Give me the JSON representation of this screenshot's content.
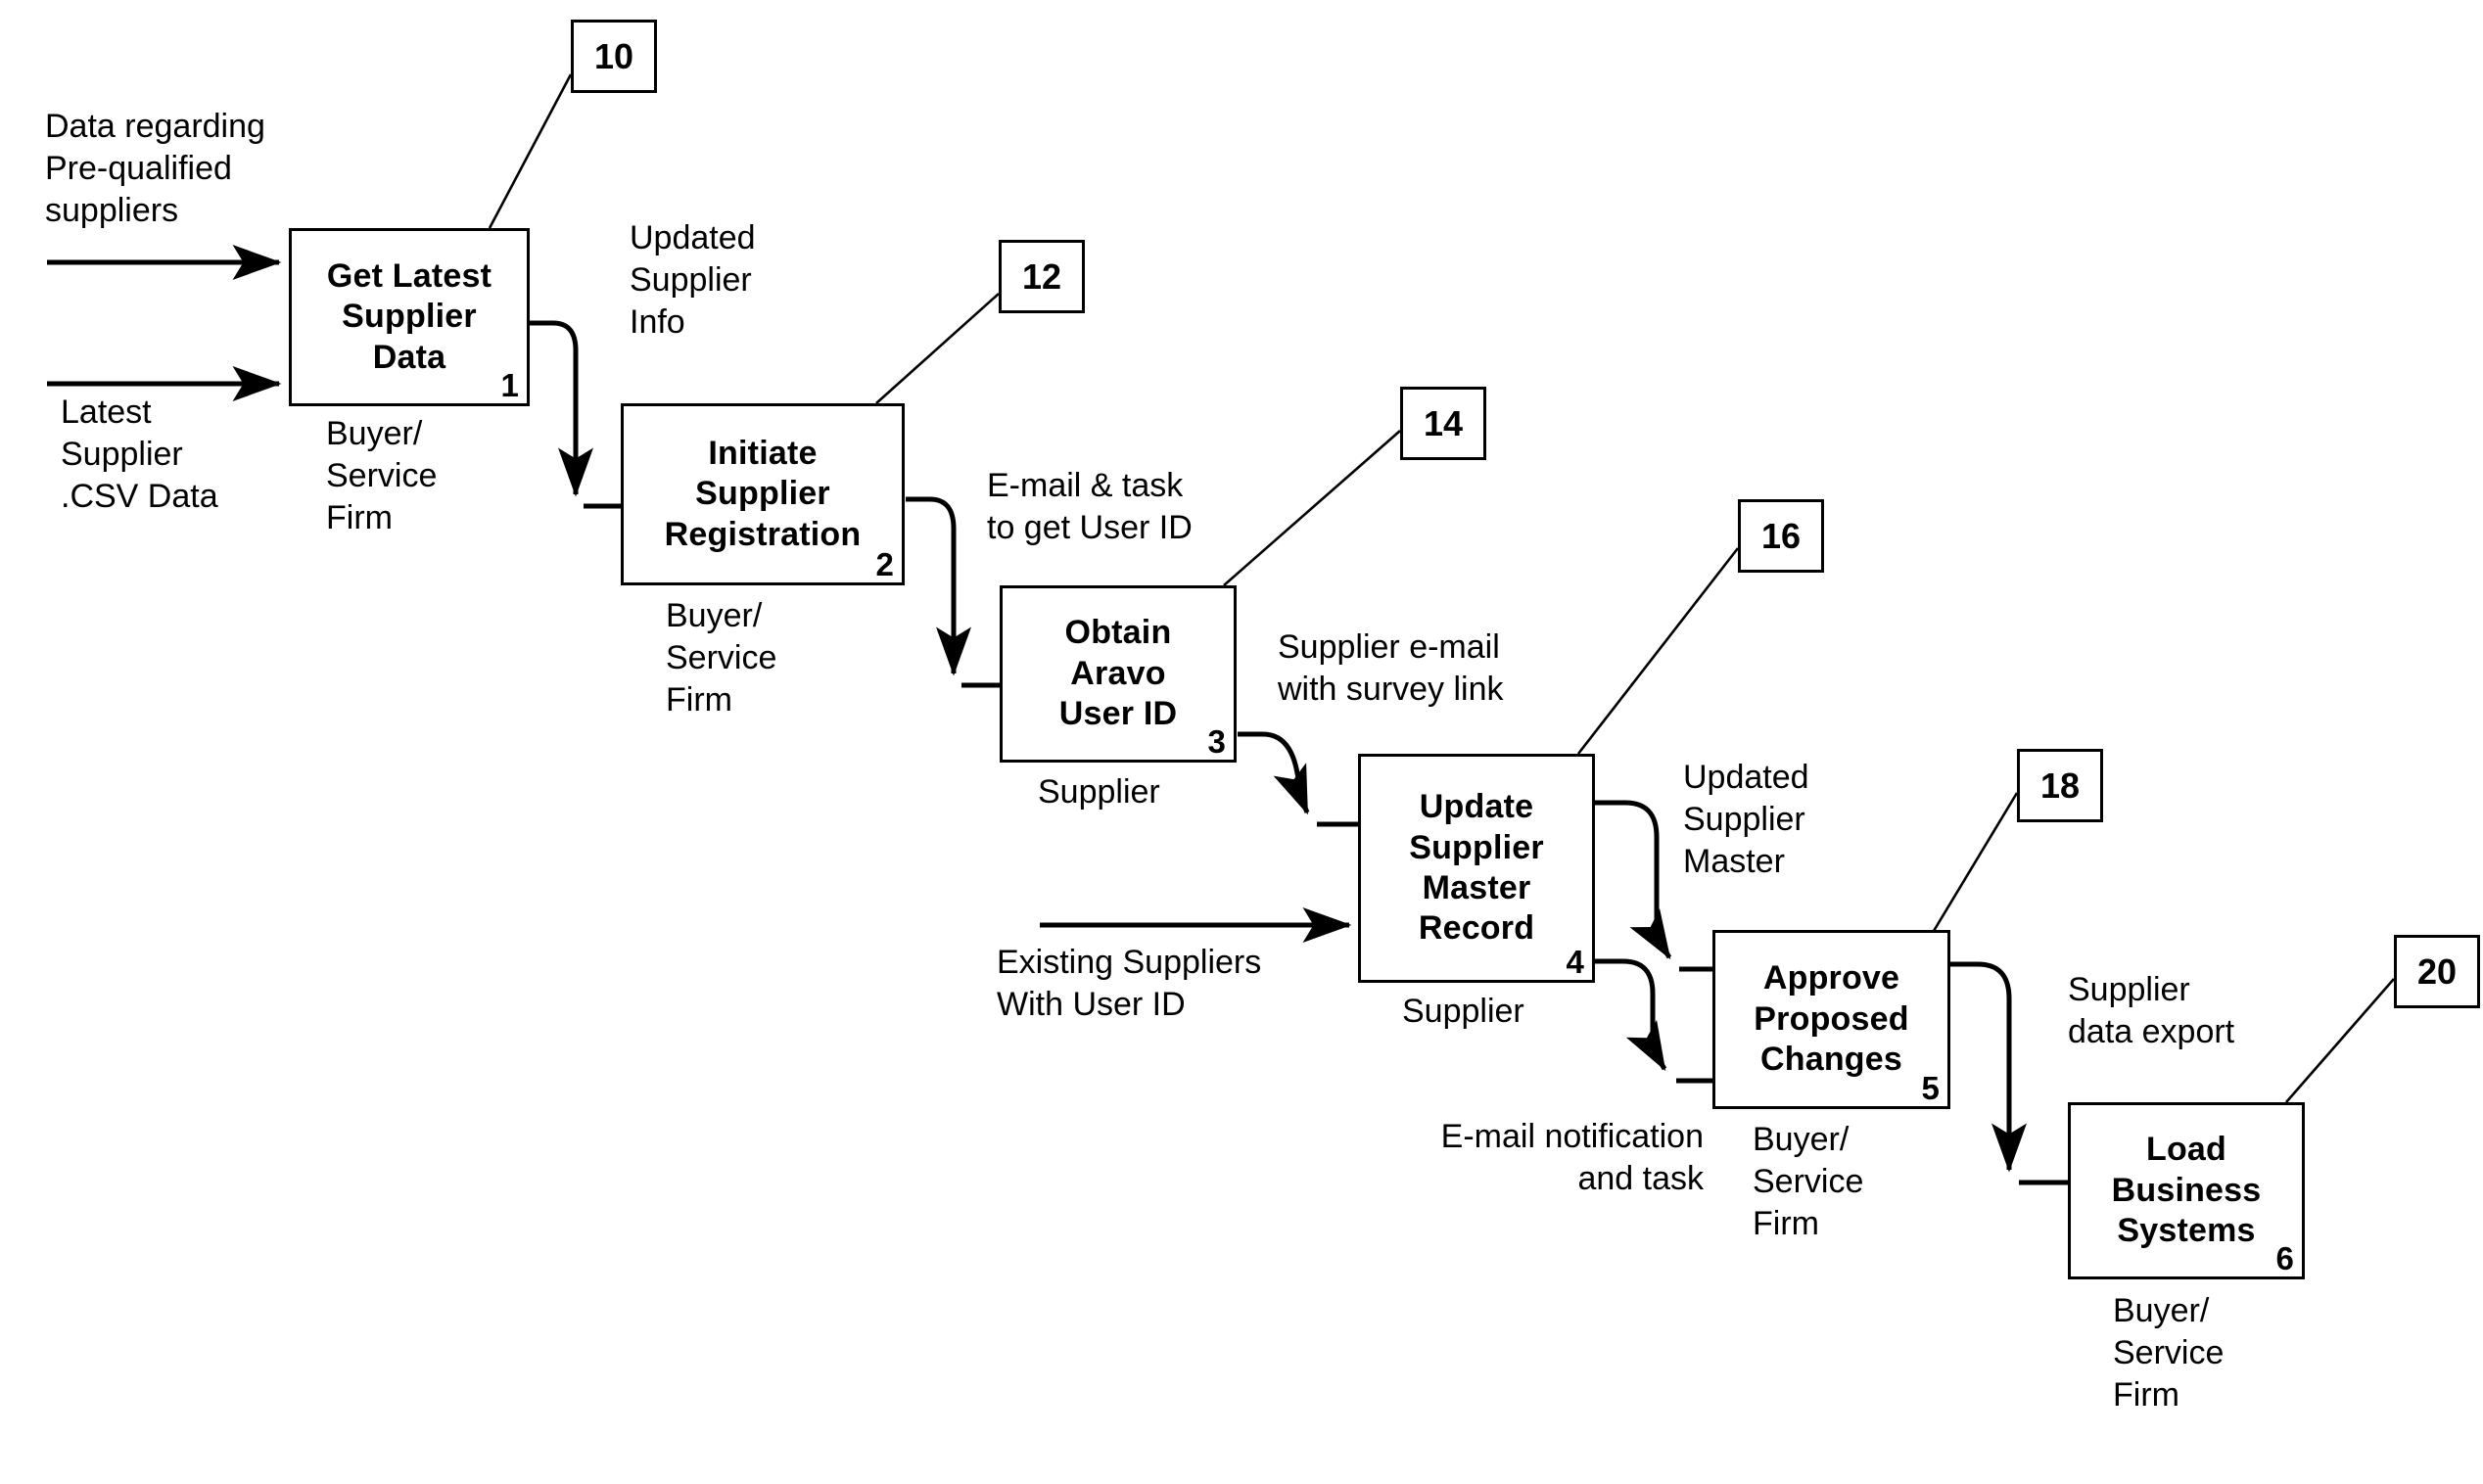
{
  "diagram": {
    "type": "flowchart",
    "title": "",
    "background_color": "#ffffff",
    "line_color": "#000000"
  },
  "processes": [
    {
      "id": "p1",
      "title": "Get Latest\nSupplier\nData",
      "number": "1",
      "role": "Buyer/\nService\nFirm",
      "reference": "10"
    },
    {
      "id": "p2",
      "title": "Initiate\nSupplier\nRegistration",
      "number": "2",
      "role": "Buyer/\nService\nFirm",
      "reference": "12"
    },
    {
      "id": "p3",
      "title": "Obtain\nAravo\nUser ID",
      "number": "3",
      "role": "Supplier",
      "reference": "14"
    },
    {
      "id": "p4",
      "title": "Update\nSupplier\nMaster\nRecord",
      "number": "4",
      "role": "Supplier",
      "reference": "16"
    },
    {
      "id": "p5",
      "title": "Approve\nProposed\nChanges",
      "number": "5",
      "role": "Buyer/\nService\nFirm",
      "reference": "18"
    },
    {
      "id": "p6",
      "title": "Load\nBusiness\nSystems",
      "number": "6",
      "role": "Buyer/\nService\nFirm",
      "reference": "20"
    }
  ],
  "flows": [
    {
      "id": "f1",
      "label": "Data regarding\nPre-qualified\nsuppliers"
    },
    {
      "id": "f2",
      "label": "Latest\nSupplier\n.CSV Data"
    },
    {
      "id": "f3",
      "label": "Updated\nSupplier\nInfo"
    },
    {
      "id": "f4",
      "label": "E-mail & task\nto get User ID"
    },
    {
      "id": "f5",
      "label": "Supplier e-mail\nwith survey link"
    },
    {
      "id": "f6",
      "label": "Existing Suppliers\nWith User ID"
    },
    {
      "id": "f7",
      "label": "Updated\nSupplier\nMaster"
    },
    {
      "id": "f8",
      "label": "E-mail notification\nand task"
    },
    {
      "id": "f9",
      "label": "Supplier\ndata export"
    }
  ]
}
